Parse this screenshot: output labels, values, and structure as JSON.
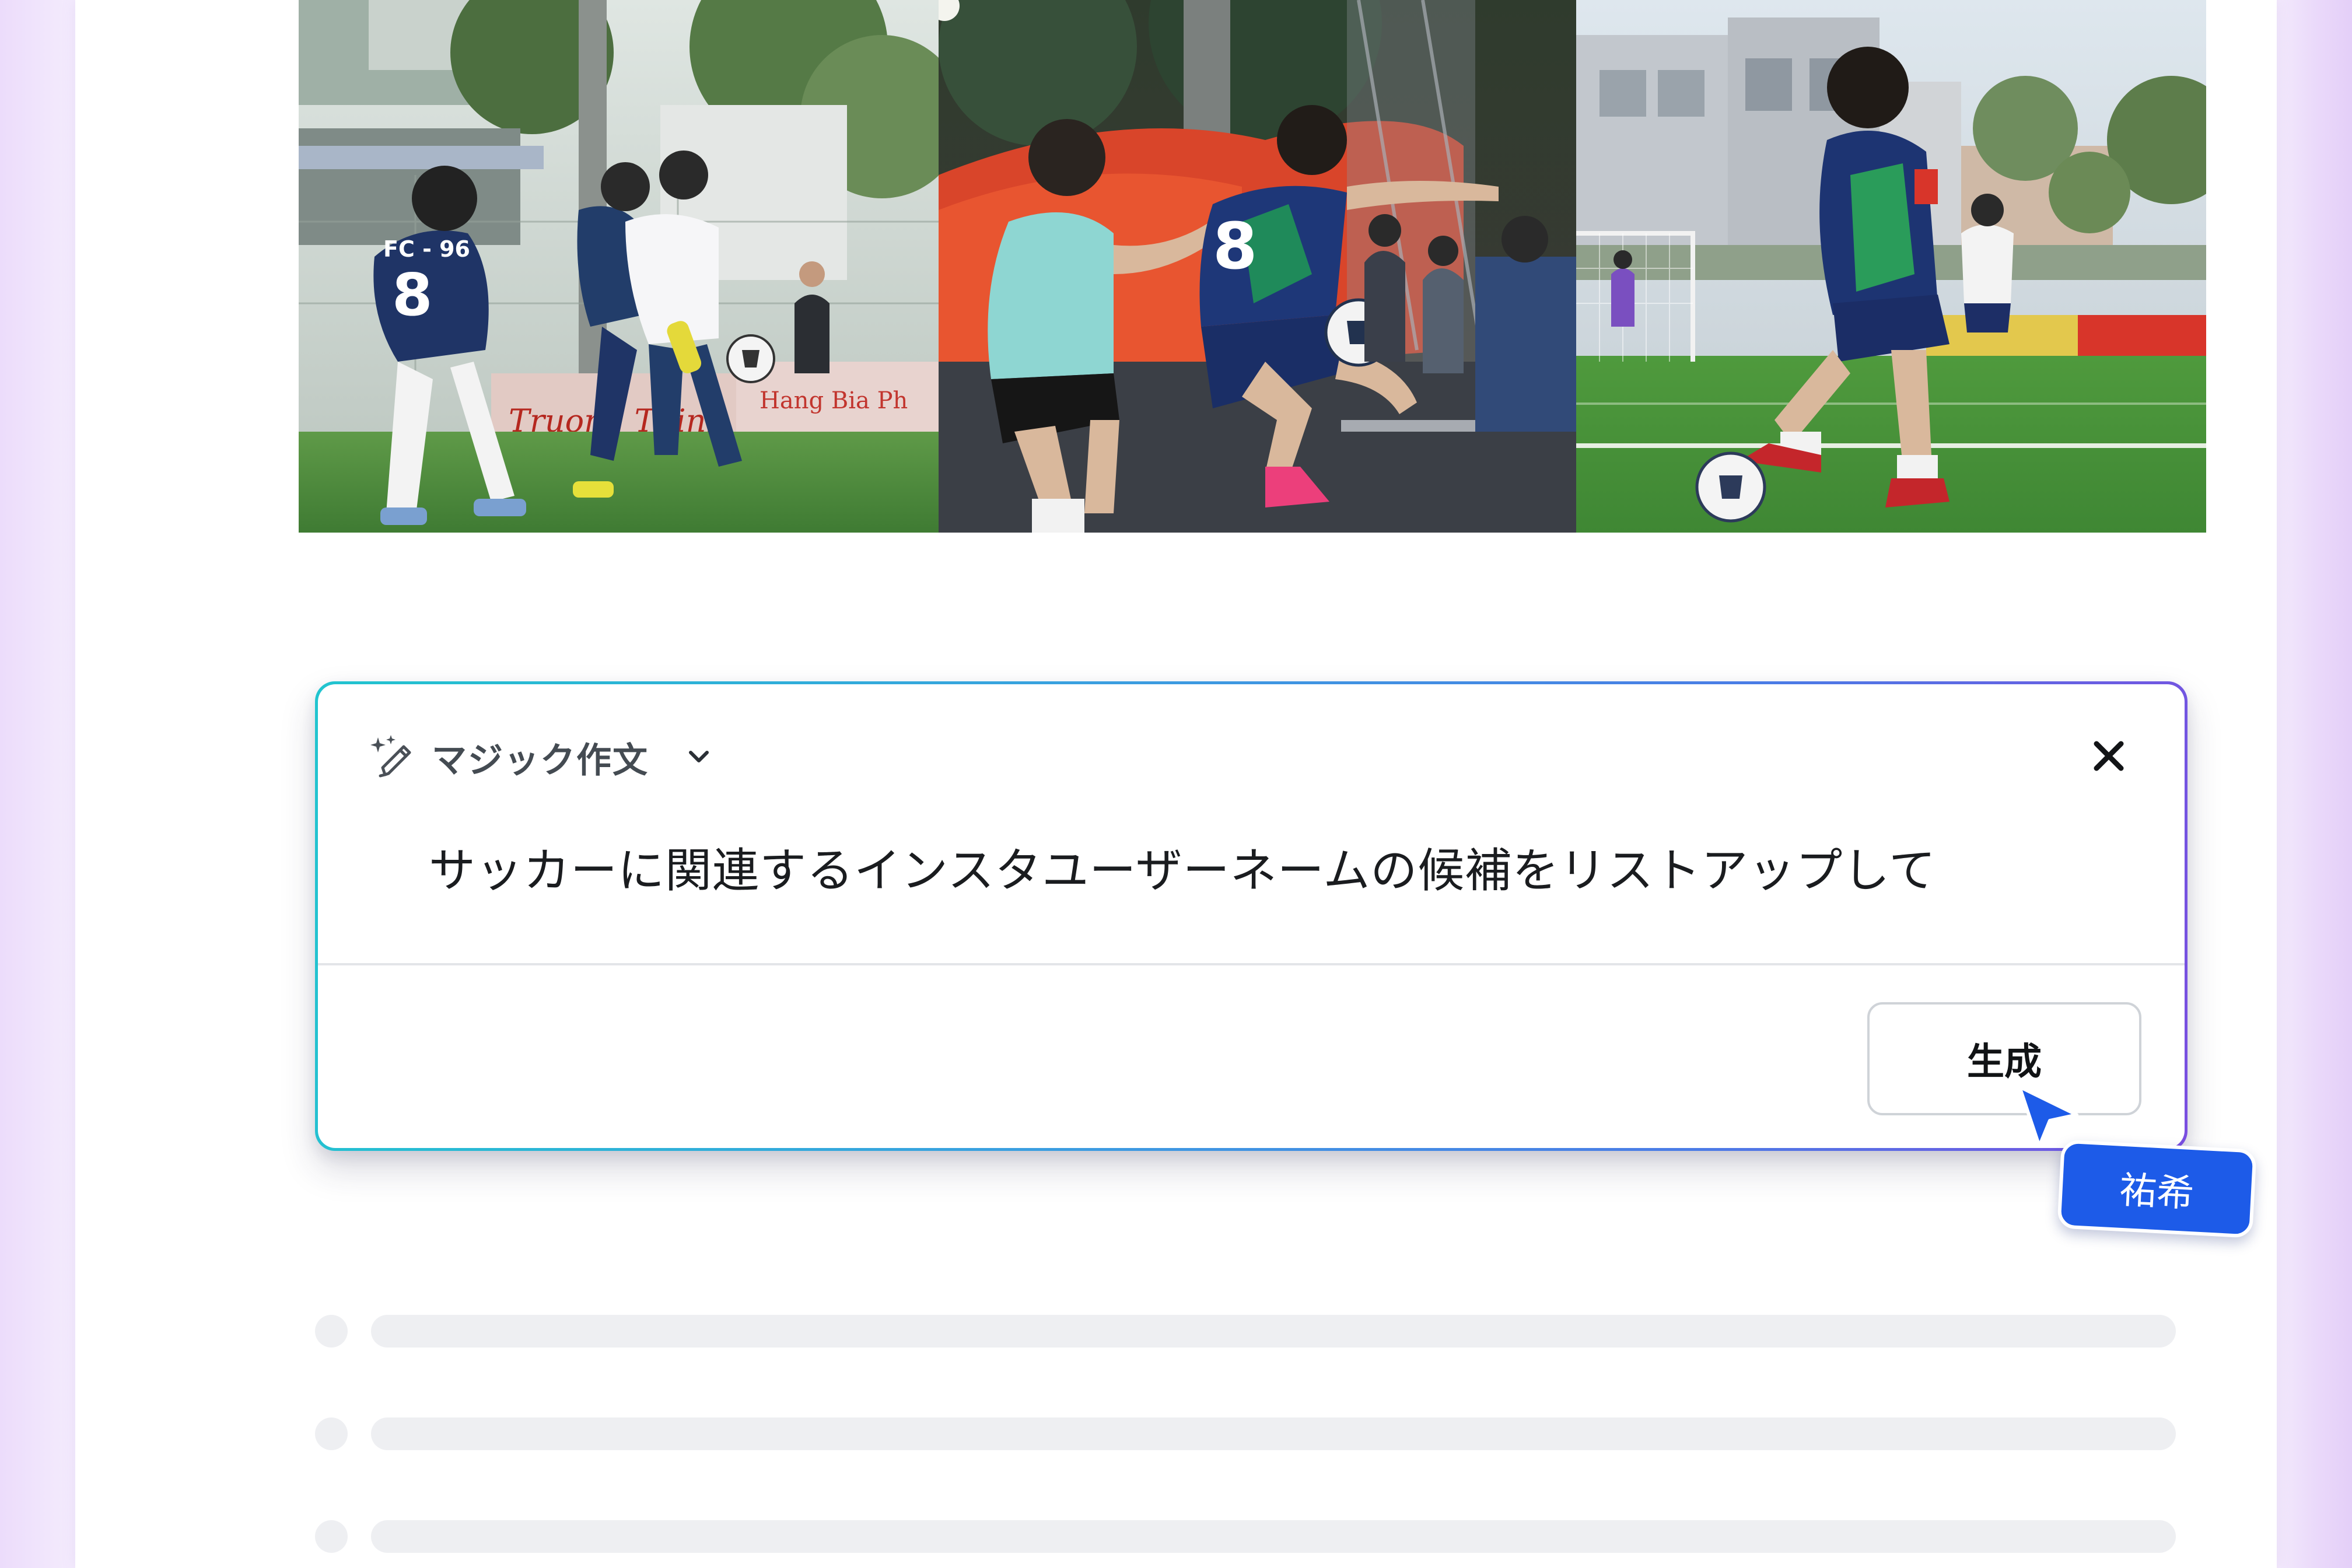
{
  "gallery": {
    "photos": [
      {
        "name": "football-photo-1",
        "jersey_text": "FC - 96",
        "jersey_number": "8",
        "banner_text": "Truong Thinh",
        "banner_text2": "Hang Bia Ph"
      },
      {
        "name": "football-photo-2",
        "jersey_number": "8"
      },
      {
        "name": "football-photo-3"
      }
    ]
  },
  "magic_write": {
    "title": "マジック作文",
    "prompt": "サッカーに関連するインスタユーザーネームの候補をリストアップして",
    "generate_label": "生成"
  },
  "collaborator": {
    "name": "祐希",
    "color": "#1d5be8"
  },
  "colors": {
    "panel_gradient_start": "#21c4cf",
    "panel_gradient_end": "#7a4ee0",
    "skeleton": "#eeeff2"
  }
}
